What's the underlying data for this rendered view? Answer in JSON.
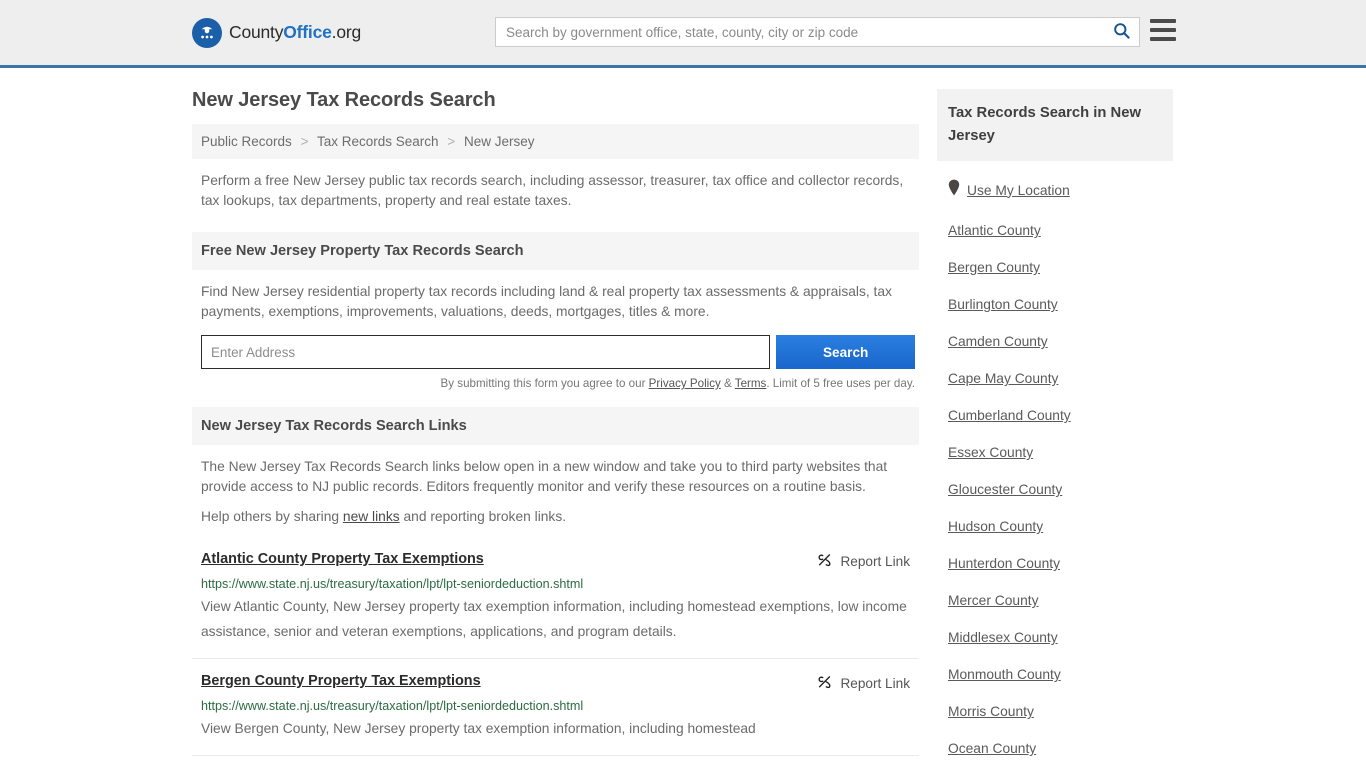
{
  "header": {
    "logo": {
      "icon": "eagle-shield-icon",
      "text_county": "County",
      "text_office": "Office",
      "text_org": ".org"
    },
    "search": {
      "placeholder": "Search by government office, state, county, city or zip code",
      "value": "",
      "icon": "search-icon"
    },
    "menu_icon": "hamburger-menu-icon"
  },
  "main": {
    "title": "New Jersey Tax Records Search",
    "breadcrumb": [
      "Public Records",
      "Tax Records Search",
      "New Jersey"
    ],
    "breadcrumb_separator": ">",
    "lead": "Perform a free New Jersey public tax records search, including assessor, treasurer, tax office and collector records, tax lookups, tax departments, property and real estate taxes.",
    "property_section": {
      "heading": "Free New Jersey Property Tax Records Search",
      "description": "Find New Jersey residential property tax records including land & real property tax assessments & appraisals, tax payments, exemptions, improvements, valuations, deeds, mortgages, titles & more.",
      "input_placeholder": "Enter Address",
      "input_value": "",
      "button_label": "Search",
      "fineprint_prefix": "By submitting this form you agree to our ",
      "fineprint_privacy": "Privacy Policy",
      "fineprint_amp": " & ",
      "fineprint_terms": "Terms",
      "fineprint_suffix": ". Limit of 5 free uses per day."
    },
    "links_section": {
      "heading": "New Jersey Tax Records Search Links",
      "paragraph1": "The New Jersey Tax Records Search links below open in a new window and take you to third party websites that provide access to NJ public records. Editors frequently monitor and verify these resources on a routine basis.",
      "paragraph2_prefix": "Help others by sharing ",
      "paragraph2_link": "new links",
      "paragraph2_suffix": " and reporting broken links."
    },
    "report_link_label": "Report Link",
    "report_link_icon": "broken-link-icon",
    "results": [
      {
        "title": "Atlantic County Property Tax Exemptions",
        "url": "https://www.state.nj.us/treasury/taxation/lpt/lpt-seniordeduction.shtml",
        "description": "View Atlantic County, New Jersey property tax exemption information, including homestead exemptions, low income assistance, senior and veteran exemptions, applications, and program details."
      },
      {
        "title": "Bergen County Property Tax Exemptions",
        "url": "https://www.state.nj.us/treasury/taxation/lpt/lpt-seniordeduction.shtml",
        "description": "View Bergen County, New Jersey property tax exemption information, including homestead"
      }
    ]
  },
  "sidebar": {
    "heading": "Tax Records Search in New Jersey",
    "location_item": {
      "label": "Use My Location",
      "icon": "map-pin-icon"
    },
    "counties": [
      "Atlantic County",
      "Bergen County",
      "Burlington County",
      "Camden County",
      "Cape May County",
      "Cumberland County",
      "Essex County",
      "Gloucester County",
      "Hudson County",
      "Hunterdon County",
      "Mercer County",
      "Middlesex County",
      "Monmouth County",
      "Morris County",
      "Ocean County"
    ]
  },
  "colors": {
    "header_bg": "#eeeeee",
    "header_border": "#3c74a8",
    "brand_blue": "#1f72c4",
    "button_blue": "#1966cc",
    "url_green": "#2c6b42",
    "panel_gray": "#f5f5f5"
  }
}
